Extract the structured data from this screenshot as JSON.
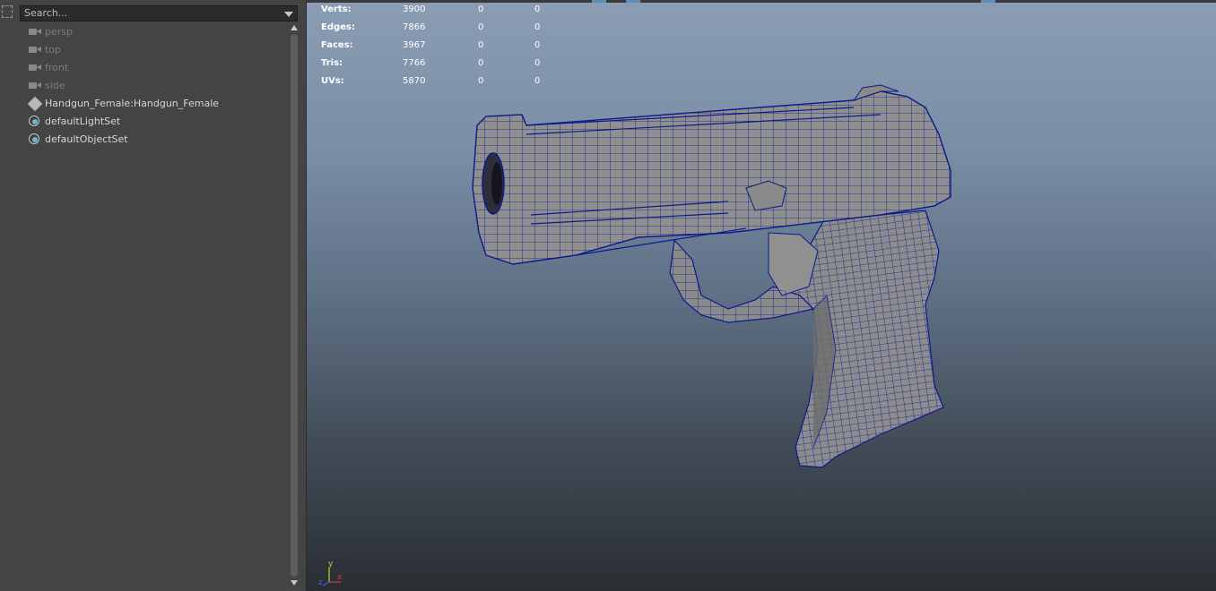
{
  "outliner": {
    "search_placeholder": "Search...",
    "items": [
      {
        "label": "persp",
        "kind": "camera",
        "icon": "camera-icon"
      },
      {
        "label": "top",
        "kind": "camera",
        "icon": "camera-icon"
      },
      {
        "label": "front",
        "kind": "camera",
        "icon": "camera-icon"
      },
      {
        "label": "side",
        "kind": "camera",
        "icon": "camera-icon"
      },
      {
        "label": "Handgun_Female:Handgun_Female",
        "kind": "object",
        "icon": "transform-node-icon"
      },
      {
        "label": "defaultLightSet",
        "kind": "set",
        "icon": "object-set-icon"
      },
      {
        "label": "defaultObjectSet",
        "kind": "set",
        "icon": "object-set-icon"
      }
    ]
  },
  "viewport": {
    "hud": [
      {
        "key": "Verts:",
        "v1": "3900",
        "v2": "0",
        "v3": "0"
      },
      {
        "key": "Edges:",
        "v1": "7866",
        "v2": "0",
        "v3": "0"
      },
      {
        "key": "Faces:",
        "v1": "3967",
        "v2": "0",
        "v3": "0"
      },
      {
        "key": "Tris:",
        "v1": "7766",
        "v2": "0",
        "v3": "0"
      },
      {
        "key": "UVs:",
        "v1": "5870",
        "v2": "0",
        "v3": "0"
      }
    ],
    "axis": {
      "x": "x",
      "y": "y",
      "z": "z"
    },
    "colors": {
      "wire": "#0b1a8c",
      "mesh": "#8a8a8a",
      "axis_x": "#d63a3a",
      "axis_y": "#9fdc4a",
      "axis_z": "#3a6ad6"
    }
  }
}
